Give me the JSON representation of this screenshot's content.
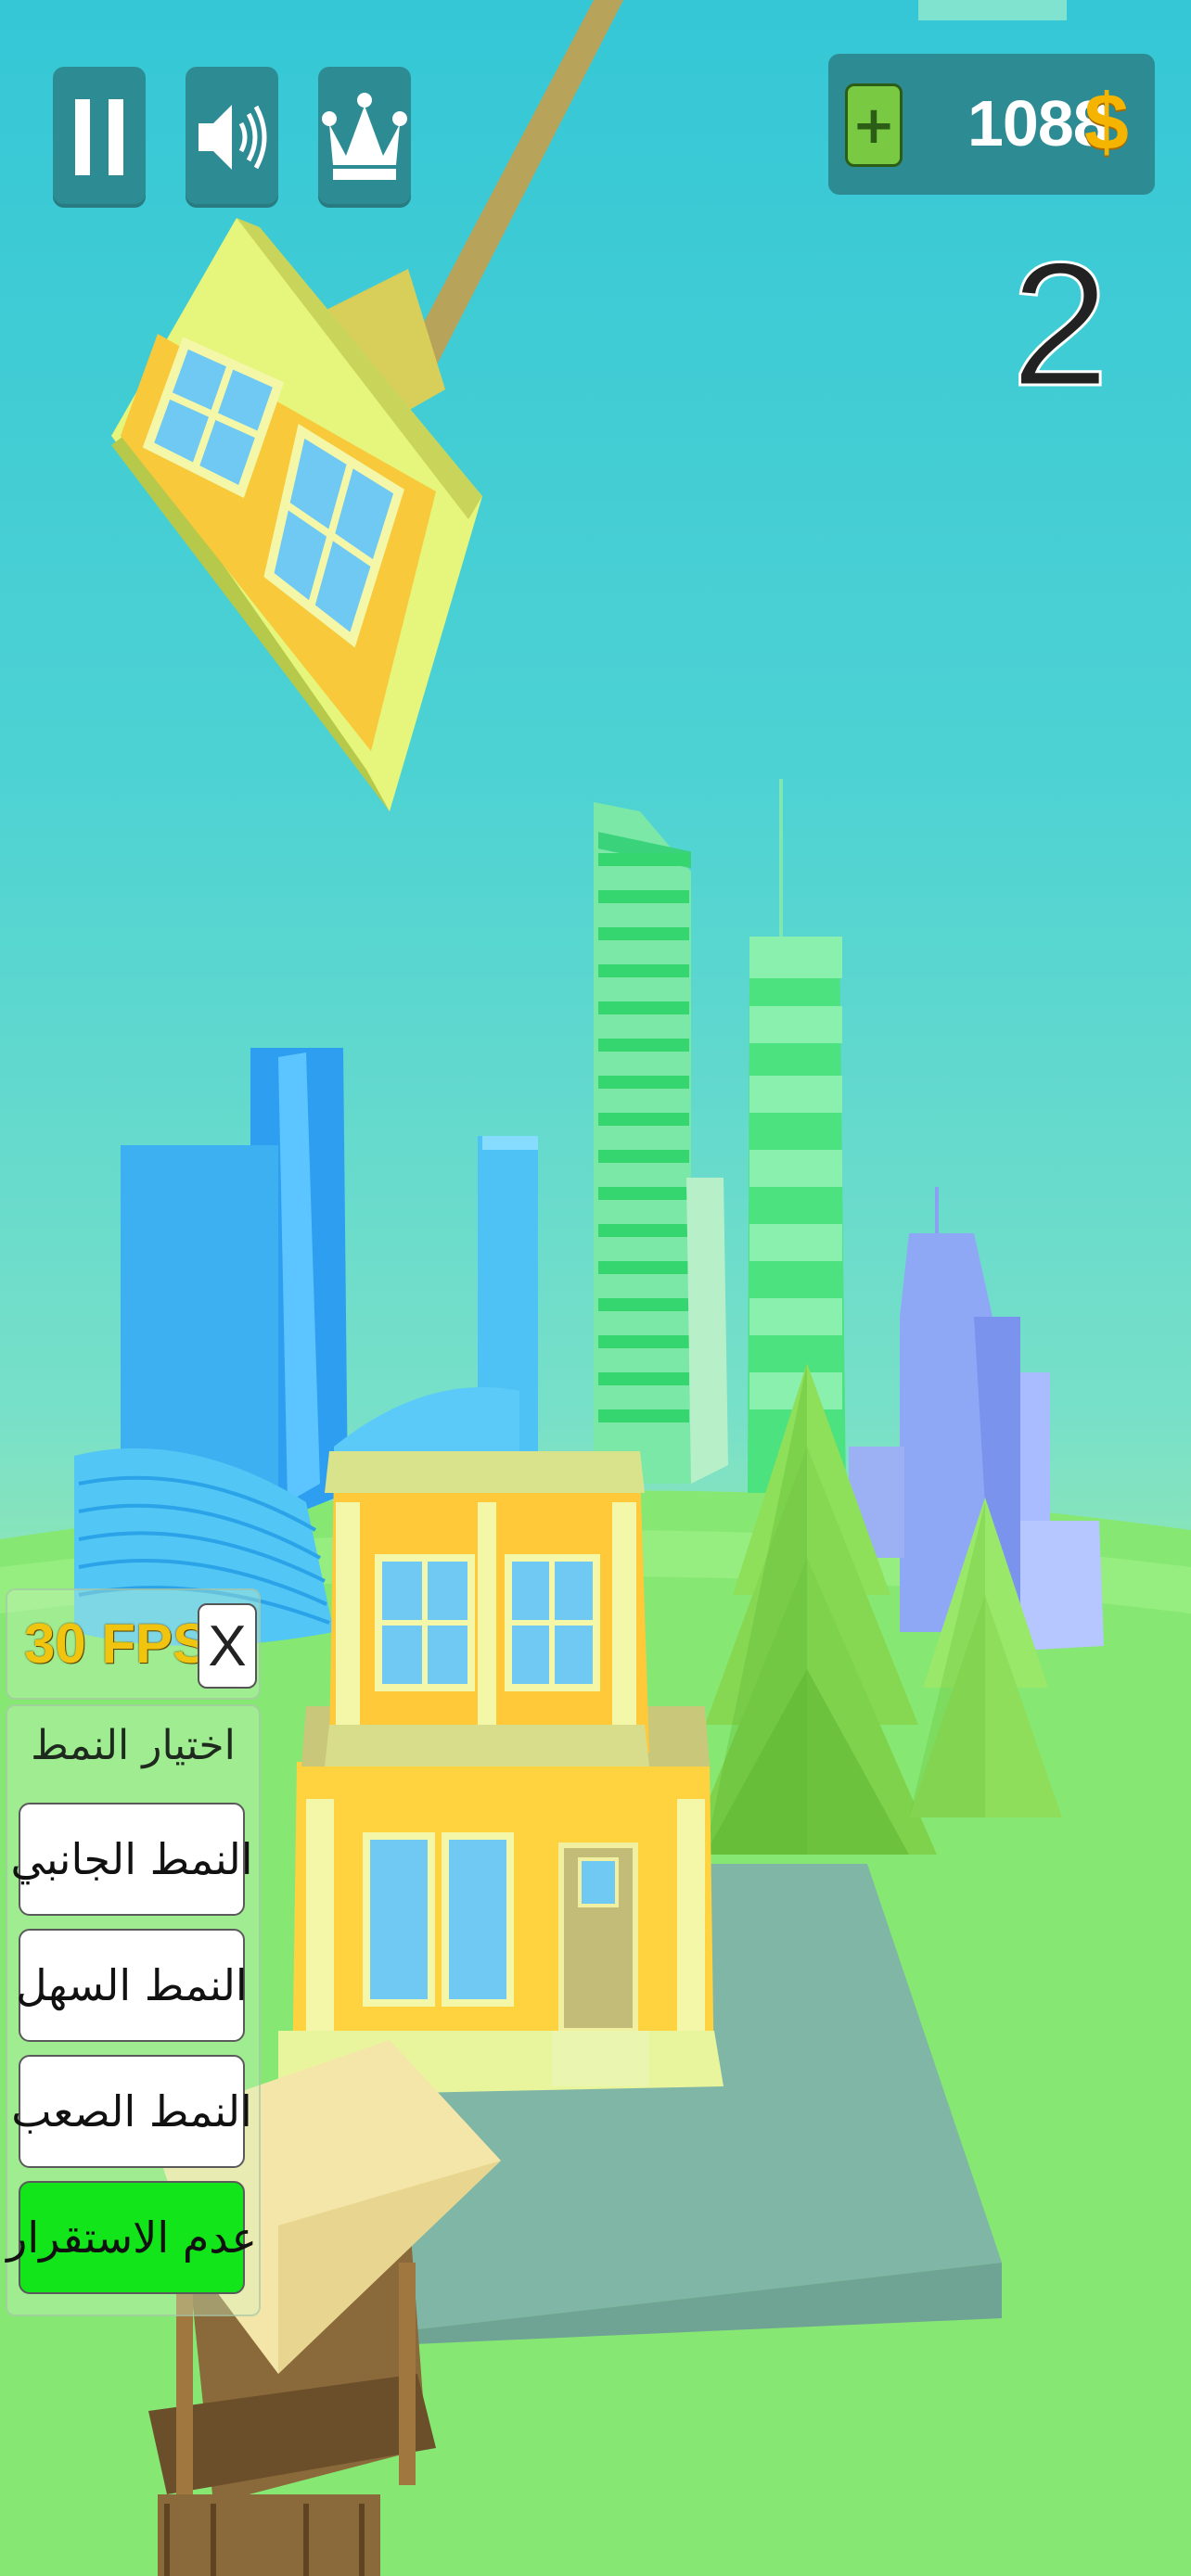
{
  "hud": {
    "pause_icon": "pause-icon",
    "sound_icon": "speaker-icon",
    "crown_icon": "crown-icon"
  },
  "coins": {
    "plus_label": "+",
    "amount": "1088",
    "symbol": "$"
  },
  "score": "2",
  "fps": {
    "label": "30 FPS",
    "close_label": "X"
  },
  "mode_panel": {
    "title": "اختيار النمط",
    "modes": [
      {
        "label": "النمط الجانبي",
        "active": false
      },
      {
        "label": "النمط السهل",
        "active": false
      },
      {
        "label": "النمط الصعب",
        "active": false
      },
      {
        "label": "عدم الاستقرار",
        "active": true
      }
    ]
  },
  "colors": {
    "hud_panel": "#2d8c93",
    "coin_symbol": "#f4b400",
    "active_mode": "#12e61a",
    "building_yellow": "#ffd23f"
  }
}
